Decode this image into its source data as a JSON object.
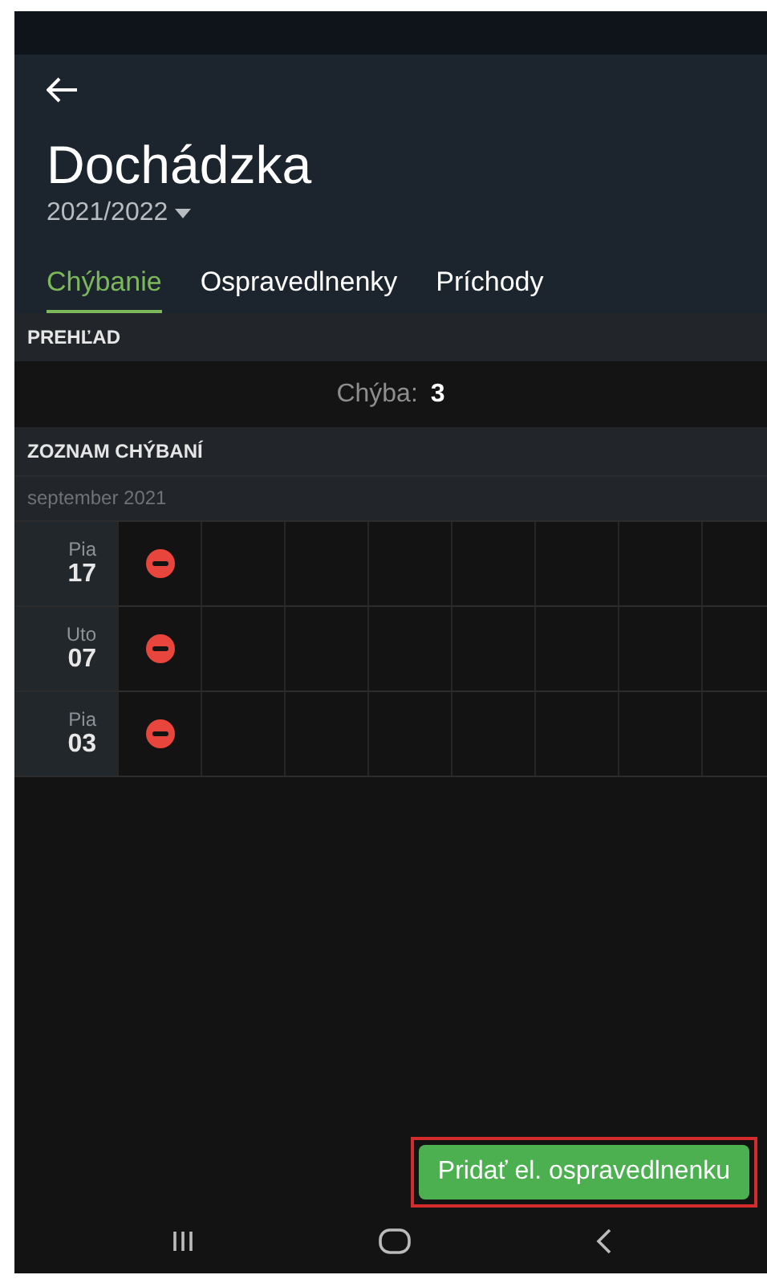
{
  "header": {
    "title": "Dochádzka",
    "school_year": "2021/2022"
  },
  "tabs": [
    {
      "label": "Chýbanie",
      "selected": true
    },
    {
      "label": "Ospravedlnenky",
      "selected": false
    },
    {
      "label": "Príchody",
      "selected": false
    }
  ],
  "overview": {
    "heading": "PREHĽAD",
    "label": "Chýba:",
    "count": "3"
  },
  "absence_list": {
    "heading": "ZOZNAM CHÝBANÍ",
    "month": "september 2021",
    "rows": [
      {
        "weekday": "Pia",
        "day": "17",
        "kind": "absent"
      },
      {
        "weekday": "Uto",
        "day": "07",
        "kind": "absent"
      },
      {
        "weekday": "Pia",
        "day": "03",
        "kind": "absent"
      }
    ]
  },
  "action_button": {
    "label": "Pridať el. ospravedlnenku",
    "highlighted": true
  }
}
